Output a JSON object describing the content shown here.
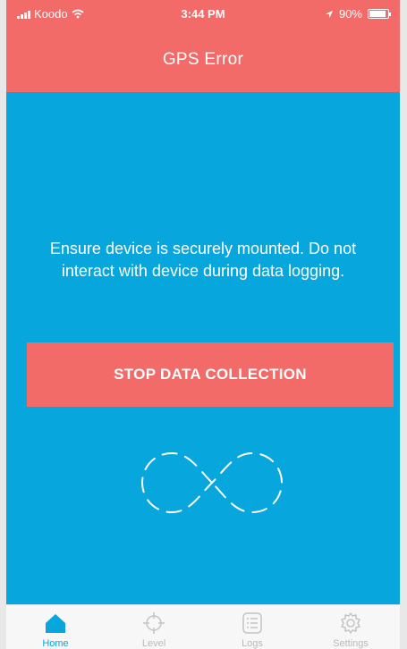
{
  "status_bar": {
    "carrier": "Koodo",
    "time": "3:44 PM",
    "battery": "90%"
  },
  "header": {
    "title": "GPS Error"
  },
  "main": {
    "message": "Ensure device is securely mounted. Do not interact with device during data logging.",
    "stop_button_label": "STOP DATA COLLECTION"
  },
  "tabbar": {
    "tabs": [
      {
        "label": "Home",
        "icon": "home-icon",
        "active": true
      },
      {
        "label": "Level",
        "icon": "crosshair-icon",
        "active": false
      },
      {
        "label": "Logs",
        "icon": "list-icon",
        "active": false
      },
      {
        "label": "Settings",
        "icon": "gear-icon",
        "active": false
      }
    ]
  },
  "colors": {
    "header": "#f26b68",
    "background": "#07a6dc",
    "button": "#f26b68",
    "active_tab": "#07a6dc"
  }
}
